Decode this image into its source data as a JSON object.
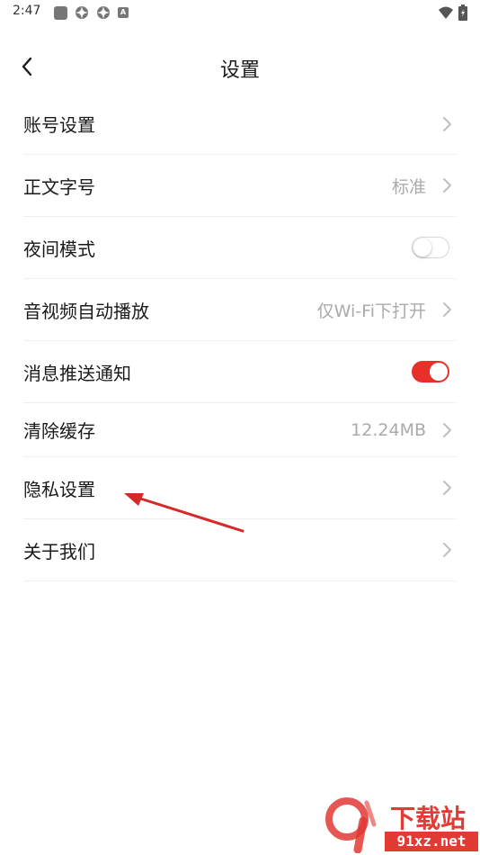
{
  "status_bar": {
    "time": "2:47",
    "notification_icons": [
      "app-square-icon",
      "gear-icon",
      "gear-icon",
      "a-box-icon"
    ],
    "a_box_text": "A",
    "right_icons": [
      "wifi-icon",
      "battery-icon"
    ]
  },
  "header": {
    "title": "设置",
    "back_icon": "chevron-left-icon"
  },
  "settings": {
    "items": [
      {
        "label": "账号设置",
        "value": "",
        "control": "chevron"
      },
      {
        "label": "正文字号",
        "value": "标准",
        "control": "chevron"
      },
      {
        "label": "夜间模式",
        "value": "",
        "control": "toggle",
        "toggle_on": false
      },
      {
        "label": "音视频自动播放",
        "value": "仅Wi-Fi下打开",
        "control": "chevron"
      },
      {
        "label": "消息推送通知",
        "value": "",
        "control": "toggle",
        "toggle_on": true
      },
      {
        "label": "清除缓存",
        "value": "12.24MB",
        "control": "chevron"
      },
      {
        "label": "隐私设置",
        "value": "",
        "control": "chevron"
      },
      {
        "label": "关于我们",
        "value": "",
        "control": "chevron"
      }
    ]
  },
  "colors": {
    "accent": "#e8302b",
    "annotation_arrow": "#d42a2a",
    "secondary_text": "#aaaaaa"
  },
  "watermark": {
    "logo_text": "下载站",
    "domain": "91xz.net"
  }
}
